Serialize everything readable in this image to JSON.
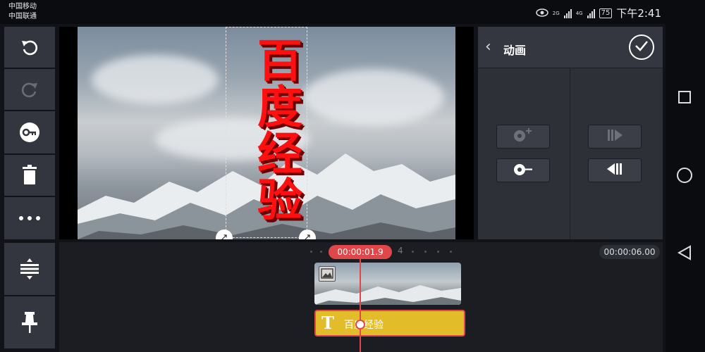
{
  "status_bar": {
    "carrier_1": "中国移动",
    "carrier_2": "中国联通",
    "network_1": "2G",
    "network_2": "4G",
    "battery": "75",
    "time": "下午2:41"
  },
  "left_toolbar": {
    "items": [
      {
        "icon": "undo-icon"
      },
      {
        "icon": "redo-icon"
      },
      {
        "icon": "keyframe-key-icon"
      },
      {
        "icon": "trash-icon"
      },
      {
        "icon": "more-icon"
      },
      {
        "icon": "timeline-expand-icon"
      },
      {
        "icon": "pin-icon"
      }
    ]
  },
  "preview": {
    "overlay_text": "百度经验",
    "text_color": "#ff1010"
  },
  "panel": {
    "title": "动画",
    "buttons": [
      {
        "icon": "add-in-animation-icon"
      },
      {
        "icon": "remove-in-animation-icon"
      },
      {
        "icon": "play-in-animation-icon"
      },
      {
        "icon": "play-out-animation-icon"
      }
    ]
  },
  "timeline": {
    "current_time": "00:00:01.9",
    "total_time": "00:00:06.00",
    "tick_label": "4",
    "text_clip_label": "百度经验",
    "accent": "#e0474a",
    "text_clip_color": "#e3bd29"
  }
}
